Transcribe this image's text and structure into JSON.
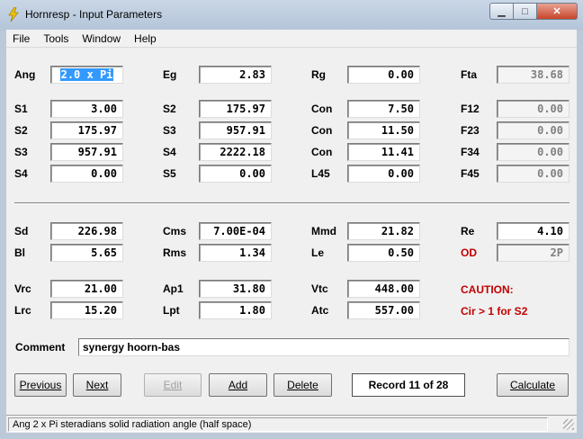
{
  "window": {
    "title": "Hornresp - Input Parameters",
    "minimize_icon": "minimize-icon",
    "maximize_icon": "maximize-icon",
    "close_icon": "close-icon"
  },
  "menu": [
    "File",
    "Tools",
    "Window",
    "Help"
  ],
  "rows": {
    "r1": [
      {
        "label": "Ang",
        "value": "2.0 x Pi",
        "selected": true
      },
      {
        "label": "Eg",
        "value": "2.83"
      },
      {
        "label": "Rg",
        "value": "0.00"
      },
      {
        "label": "Fta",
        "value": "38.68",
        "readonly": true
      }
    ],
    "r2": [
      {
        "label": "S1",
        "value": "3.00"
      },
      {
        "label": "S2",
        "value": "175.97"
      },
      {
        "label": "Con",
        "value": "7.50"
      },
      {
        "label": "F12",
        "value": "0.00",
        "readonly": true
      }
    ],
    "r3": [
      {
        "label": "S2",
        "value": "175.97"
      },
      {
        "label": "S3",
        "value": "957.91"
      },
      {
        "label": "Con",
        "value": "11.50"
      },
      {
        "label": "F23",
        "value": "0.00",
        "readonly": true
      }
    ],
    "r4": [
      {
        "label": "S3",
        "value": "957.91"
      },
      {
        "label": "S4",
        "value": "2222.18"
      },
      {
        "label": "Con",
        "value": "11.41"
      },
      {
        "label": "F34",
        "value": "0.00",
        "readonly": true
      }
    ],
    "r5": [
      {
        "label": "S4",
        "value": "0.00"
      },
      {
        "label": "S5",
        "value": "0.00"
      },
      {
        "label": "L45",
        "value": "0.00"
      },
      {
        "label": "F45",
        "value": "0.00",
        "readonly": true
      }
    ],
    "r6": [
      {
        "label": "Sd",
        "value": "226.98"
      },
      {
        "label": "Cms",
        "value": "7.00E-04"
      },
      {
        "label": "Mmd",
        "value": "21.82"
      },
      {
        "label": "Re",
        "value": "4.10"
      }
    ],
    "r7": [
      {
        "label": "Bl",
        "value": "5.65"
      },
      {
        "label": "Rms",
        "value": "1.34"
      },
      {
        "label": "Le",
        "value": "0.50"
      },
      {
        "label": "OD",
        "value": "2P",
        "readonly": true
      }
    ],
    "r8": [
      {
        "label": "Vrc",
        "value": "21.00"
      },
      {
        "label": "Ap1",
        "value": "31.80"
      },
      {
        "label": "Vtc",
        "value": "448.00"
      }
    ],
    "r9": [
      {
        "label": "Lrc",
        "value": "15.20"
      },
      {
        "label": "Lpt",
        "value": "1.80"
      },
      {
        "label": "Atc",
        "value": "557.00"
      }
    ]
  },
  "caution": {
    "title": "CAUTION:",
    "message": "Cir > 1 for S2"
  },
  "comment": {
    "label": "Comment",
    "value": "synergy hoorn-bas"
  },
  "buttons": {
    "previous": "Previous",
    "next": "Next",
    "edit": "Edit",
    "add": "Add",
    "delete": "Delete",
    "calculate": "Calculate"
  },
  "record": "Record 11 of 28",
  "status": "Ang   2 x Pi steradians solid radiation angle  (half space)",
  "colors": {
    "label_red": "#c00000",
    "selection": "#3399ff"
  }
}
